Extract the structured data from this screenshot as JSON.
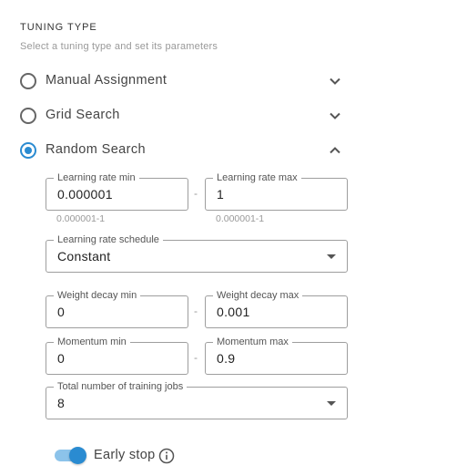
{
  "section": {
    "title": "TUNING TYPE",
    "subtitle": "Select a tuning type and set its parameters"
  },
  "options": [
    {
      "label": "Manual Assignment",
      "selected": false,
      "expanded": false
    },
    {
      "label": "Grid Search",
      "selected": false,
      "expanded": false
    },
    {
      "label": "Random Search",
      "selected": true,
      "expanded": true
    }
  ],
  "fields": {
    "lr_min": {
      "label": "Learning rate min",
      "value": "0.000001",
      "hint": "0.000001-1"
    },
    "lr_max": {
      "label": "Learning rate max",
      "value": "1",
      "hint": "0.000001-1"
    },
    "lr_schedule": {
      "label": "Learning rate schedule",
      "value": "Constant"
    },
    "wd_min": {
      "label": "Weight decay min",
      "value": "0"
    },
    "wd_max": {
      "label": "Weight decay max",
      "value": "0.001"
    },
    "mom_min": {
      "label": "Momentum min",
      "value": "0"
    },
    "mom_max": {
      "label": "Momentum max",
      "value": "0.9"
    },
    "total_jobs": {
      "label": "Total number of training jobs",
      "value": "8"
    },
    "separator": "-"
  },
  "early_stop": {
    "label": "Early stop",
    "enabled": true
  },
  "colors": {
    "accent": "#2a8bd1",
    "accent_track": "#8cc3ea",
    "border": "#9e9e9e"
  },
  "icons": {
    "expand": "chevron-down-icon",
    "collapse": "chevron-up-icon",
    "info": "info-icon"
  }
}
